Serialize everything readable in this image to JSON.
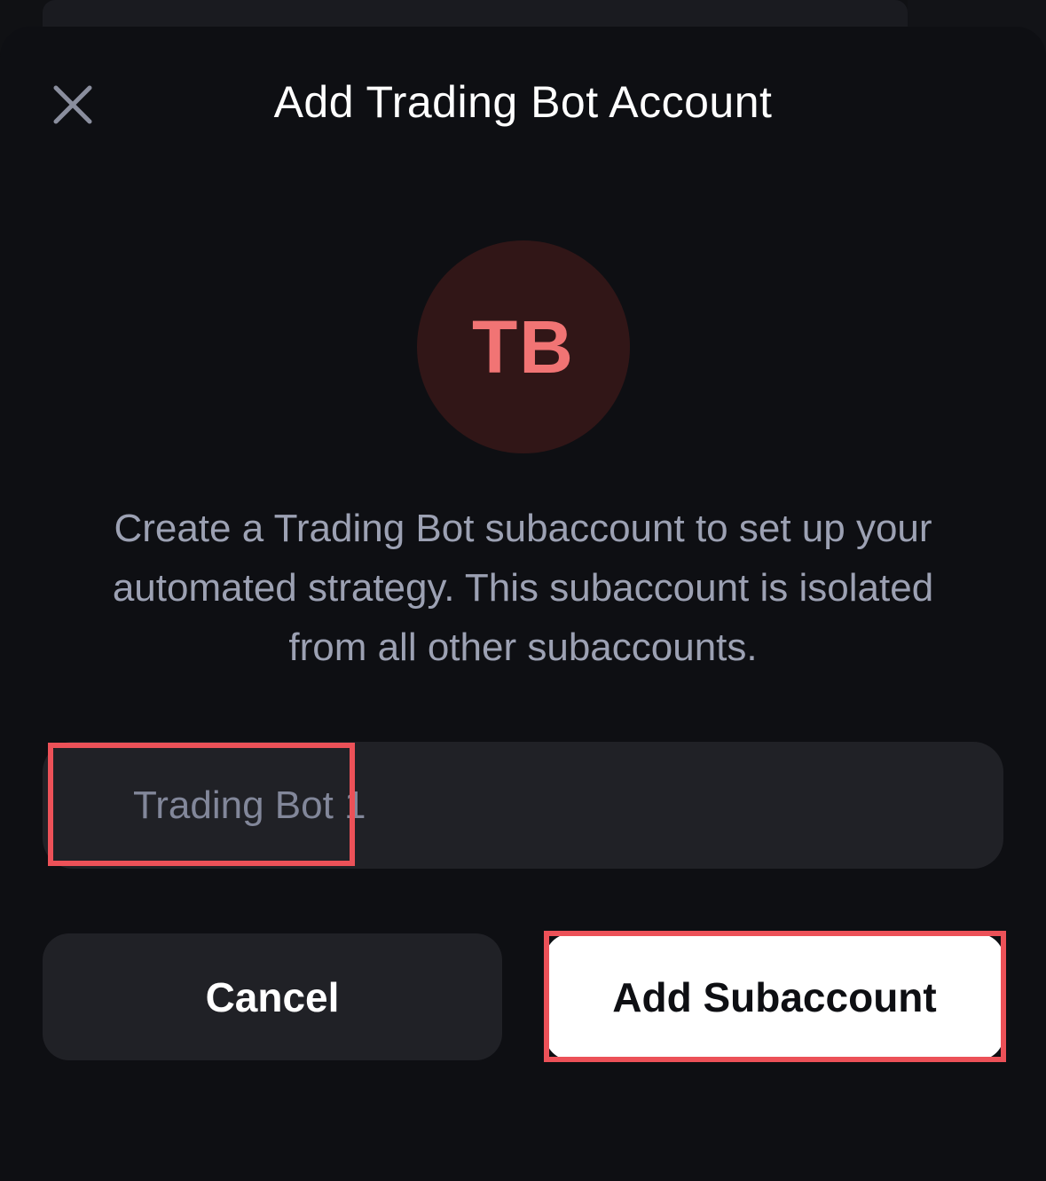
{
  "dialog": {
    "title": "Add Trading Bot Account",
    "close_icon": "close-icon"
  },
  "avatar": {
    "initials": "TB",
    "background": "#311617",
    "text_color": "#f17474"
  },
  "description": "Create a Trading Bot subaccount to set up your automated strategy. This subaccount is isolated from all other subaccounts.",
  "name_input": {
    "placeholder": "Trading Bot 1",
    "value": ""
  },
  "actions": {
    "cancel_label": "Cancel",
    "add_label": "Add Subaccount"
  },
  "colors": {
    "background": "#0e0f13",
    "surface": "#202126",
    "highlight": "#ec5158",
    "primary_button": "#ffffff"
  }
}
